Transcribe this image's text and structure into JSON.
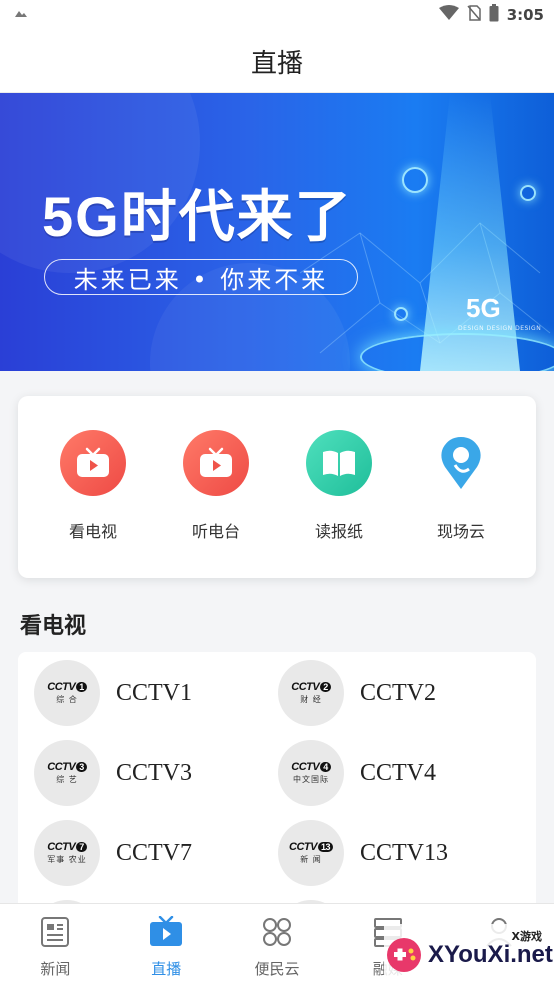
{
  "status_bar": {
    "time": "3:05"
  },
  "header": {
    "title": "直播"
  },
  "banner": {
    "headline": "5G时代来了",
    "slogan": "未来已来 • 你来不来",
    "tag": "5G",
    "tag_sub": "DESIGN DESIGN DESIGN"
  },
  "menu": {
    "items": [
      {
        "label": "看电视",
        "icon": "tv-icon",
        "color": "#f2544c"
      },
      {
        "label": "听电台",
        "icon": "radio-icon",
        "color": "#f2544c"
      },
      {
        "label": "读报纸",
        "icon": "book-icon",
        "color": "#26c9a4"
      },
      {
        "label": "现场云",
        "icon": "location-pin-icon",
        "color": "#3aa7e8"
      }
    ]
  },
  "section": {
    "title": "看电视"
  },
  "channels": [
    {
      "name": "CCTV1",
      "logo_num": "1",
      "logo_sub": "综 合"
    },
    {
      "name": "CCTV2",
      "logo_num": "2",
      "logo_sub": "财 经"
    },
    {
      "name": "CCTV3",
      "logo_num": "3",
      "logo_sub": "综 艺"
    },
    {
      "name": "CCTV4",
      "logo_num": "4",
      "logo_sub": "中文国际"
    },
    {
      "name": "CCTV7",
      "logo_num": "7",
      "logo_sub": "军事 农业"
    },
    {
      "name": "CCTV13",
      "logo_num": "13",
      "logo_sub": "新 闻"
    }
  ],
  "logo_brand": "CCTV",
  "tabbar": {
    "tabs": [
      {
        "label": "新闻",
        "icon": "news-icon"
      },
      {
        "label": "直播",
        "icon": "live-tv-icon"
      },
      {
        "label": "便民云",
        "icon": "grid-icon"
      },
      {
        "label": "融媒",
        "icon": "stack-icon"
      },
      {
        "label": "",
        "icon": "profile-icon"
      }
    ],
    "active_color": "#2f8fe6"
  },
  "watermark": {
    "text": "XYouXi.net",
    "small": "X游戏"
  }
}
